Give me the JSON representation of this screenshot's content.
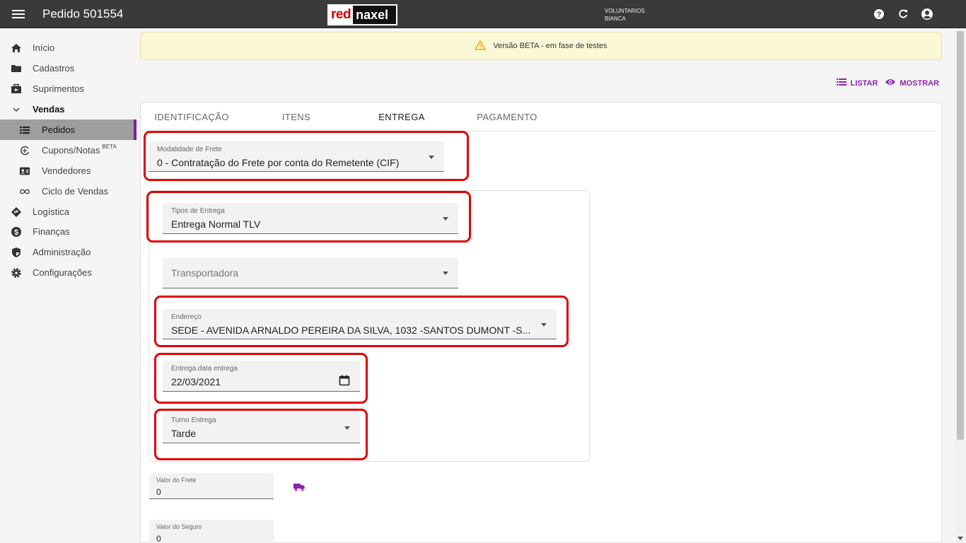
{
  "appbar": {
    "title": "Pedido 501554",
    "logo_left": "red",
    "logo_right": "naxel",
    "user_line1": "VOLUNTARIOS",
    "user_line2": "BIANCA",
    "icons": [
      "help-icon",
      "refresh-icon",
      "account-icon"
    ]
  },
  "sidebar": {
    "items": [
      {
        "label": "Início",
        "icon": "home-icon"
      },
      {
        "label": "Cadastros",
        "icon": "folder-icon"
      },
      {
        "label": "Suprimentos",
        "icon": "supply-icon"
      },
      {
        "label": "Vendas",
        "icon": "chevron-down-icon"
      },
      {
        "label": "Pedidos",
        "icon": "list-icon"
      },
      {
        "label": "Cupons/Notas",
        "badge": "BETA",
        "icon": "receipt-icon"
      },
      {
        "label": "Vendedores",
        "icon": "contact-card-icon"
      },
      {
        "label": "Ciclo de Vendas",
        "icon": "infinity-icon"
      },
      {
        "label": "Logística",
        "icon": "directions-icon"
      },
      {
        "label": "Finanças",
        "icon": "dollar-icon"
      },
      {
        "label": "Administração",
        "icon": "shield-icon"
      },
      {
        "label": "Configurações",
        "icon": "gear-icon"
      }
    ]
  },
  "banner": {
    "text": "Versão BETA - em fase de testes"
  },
  "toplinks": {
    "listar": "LISTAR",
    "mostrar": "MOSTRAR"
  },
  "tabs": [
    {
      "label": "IDENTIFICAÇÃO"
    },
    {
      "label": "ITENS"
    },
    {
      "label": "ENTREGA"
    },
    {
      "label": "PAGAMENTO"
    }
  ],
  "form": {
    "modalidade": {
      "label": "Modalidade de Frete",
      "value": "0 - Contratação do Frete por conta do Remetente (CIF)"
    },
    "tipos": {
      "label": "Tipos de Entrega",
      "value": "Entrega Normal TLV"
    },
    "transportadora": {
      "placeholder": "Transportadora"
    },
    "endereco": {
      "label": "Endereço",
      "value": "SEDE - AVENIDA ARNALDO PEREIRA DA SILVA, 1032 -SANTOS DUMONT -S..."
    },
    "data": {
      "label": "Entrega.data entrega",
      "value": "22/03/2021"
    },
    "turno": {
      "label": "Turno Entrega",
      "value": "Tarde"
    },
    "valor_frete": {
      "label": "Valor do Frete",
      "value": "0"
    },
    "valor_seguro": {
      "label": "Valor do Seguro",
      "value": "0"
    }
  },
  "colors": {
    "accent": "#8e24aa",
    "highlight": "#e00000",
    "appbar": "#3a3a3a"
  }
}
